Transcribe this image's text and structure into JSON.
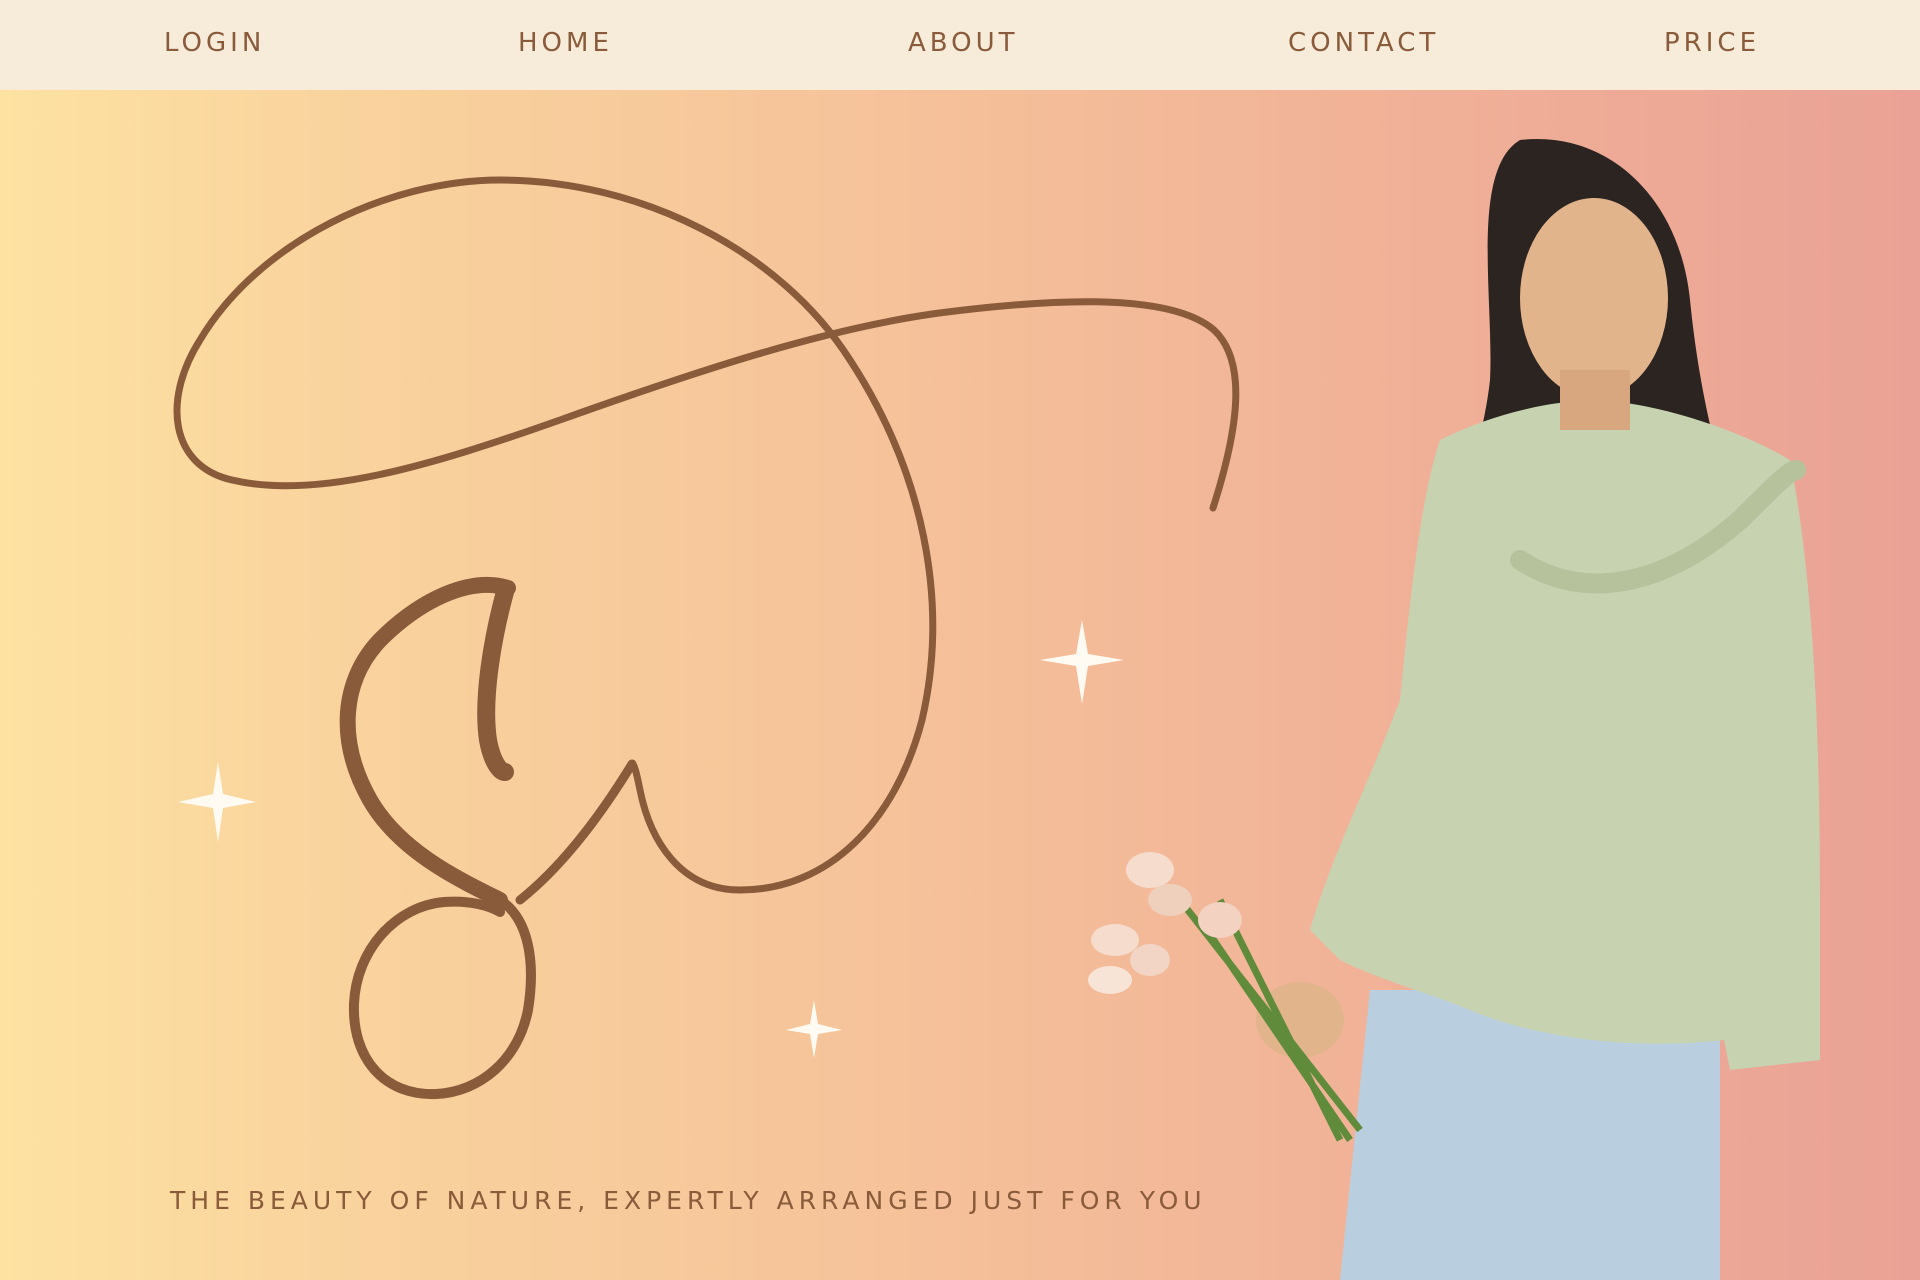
{
  "nav": {
    "items": [
      {
        "label": "LOGIN"
      },
      {
        "label": "HOME"
      },
      {
        "label": "ABOUT"
      },
      {
        "label": "CONTACT"
      },
      {
        "label": "PRICE"
      }
    ]
  },
  "hero": {
    "tagline": "THE BEAUTY OF NATURE, EXPERTLY ARRANGED JUST FOR YOU"
  },
  "colors": {
    "nav_background": "#f6ecd9",
    "accent_brown": "#8a5b3a",
    "gradient_left": "#fde2a2",
    "gradient_right": "#e9a295"
  },
  "icons": [
    "sparkle-icon",
    "monogram-logo"
  ]
}
